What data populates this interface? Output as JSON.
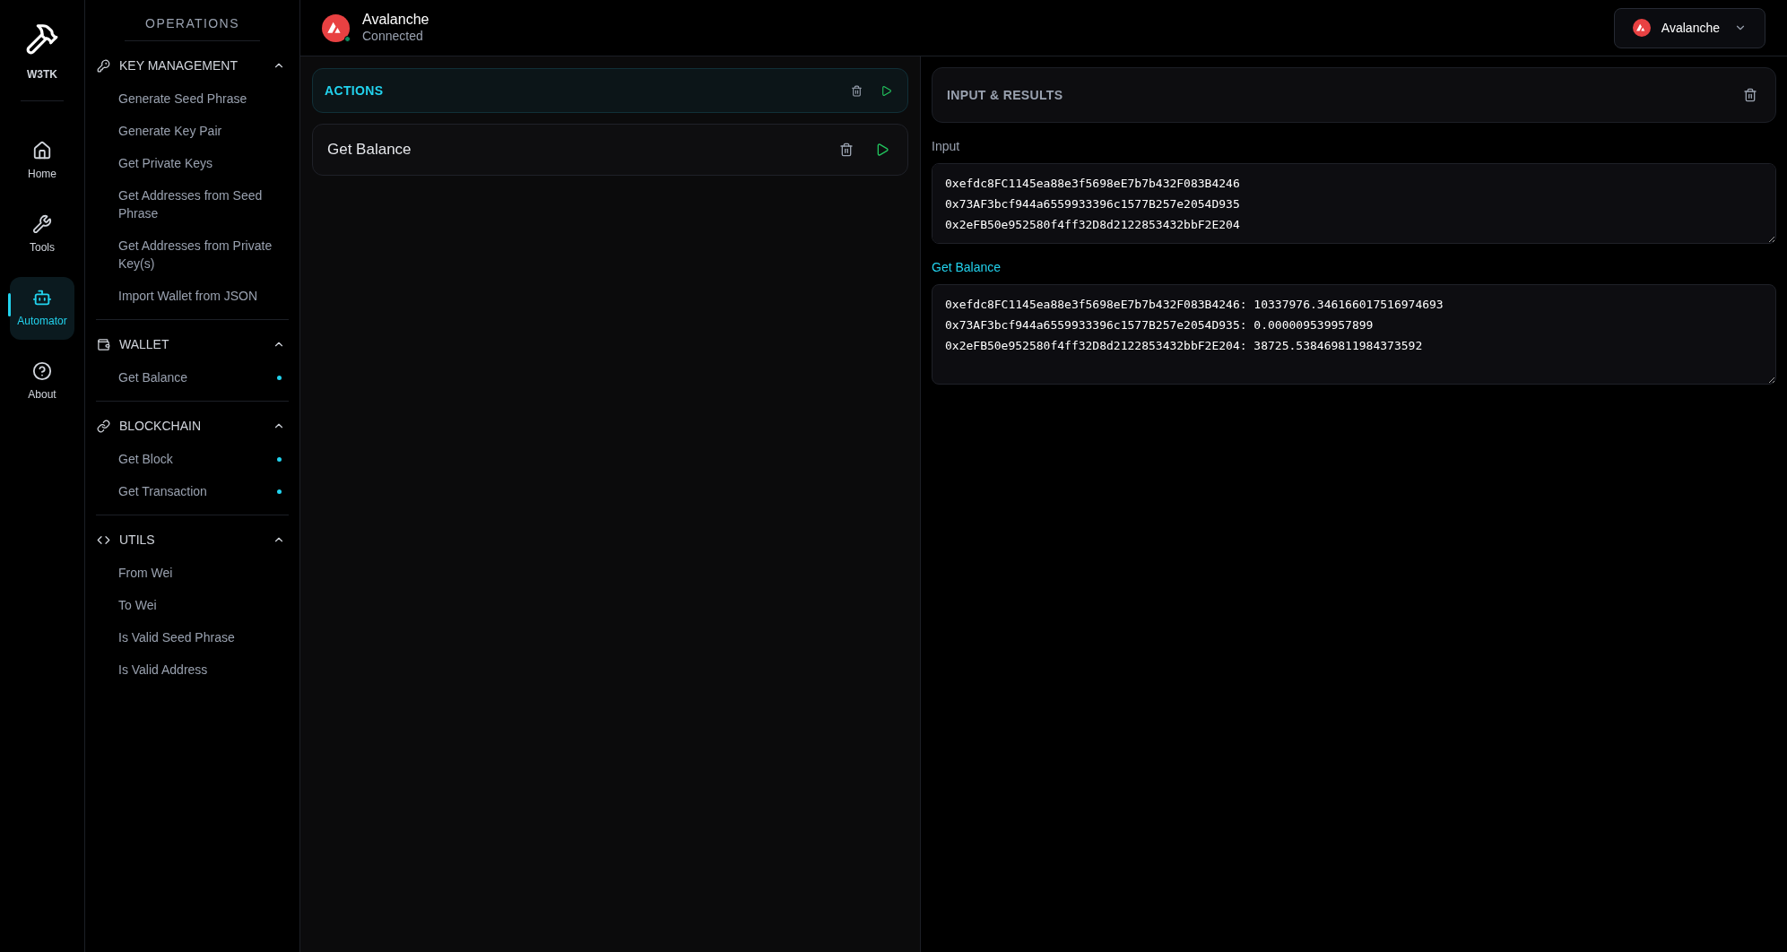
{
  "brand": {
    "name": "W3TK"
  },
  "nav": [
    {
      "label": "Home",
      "selected": false
    },
    {
      "label": "Tools",
      "selected": false
    },
    {
      "label": "Automator",
      "selected": true
    },
    {
      "label": "About",
      "selected": false
    }
  ],
  "operations": {
    "title": "OPERATIONS",
    "sections": [
      {
        "title": "KEY MANAGEMENT",
        "expanded": true,
        "items": [
          {
            "label": "Generate Seed Phrase",
            "marked": false
          },
          {
            "label": "Generate Key Pair",
            "marked": false
          },
          {
            "label": "Get Private Keys",
            "marked": false
          },
          {
            "label": "Get Addresses from Seed Phrase",
            "marked": false
          },
          {
            "label": "Get Addresses from Private Key(s)",
            "marked": false
          },
          {
            "label": "Import Wallet from JSON",
            "marked": false
          }
        ]
      },
      {
        "title": "WALLET",
        "expanded": true,
        "items": [
          {
            "label": "Get Balance",
            "marked": true
          }
        ]
      },
      {
        "title": "BLOCKCHAIN",
        "expanded": true,
        "items": [
          {
            "label": "Get Block",
            "marked": true
          },
          {
            "label": "Get Transaction",
            "marked": true
          }
        ]
      },
      {
        "title": "UTILS",
        "expanded": true,
        "items": [
          {
            "label": "From Wei",
            "marked": false
          },
          {
            "label": "To Wei",
            "marked": false
          },
          {
            "label": "Is Valid Seed Phrase",
            "marked": false
          },
          {
            "label": "Is Valid Address",
            "marked": false
          }
        ]
      }
    ]
  },
  "header": {
    "network": "Avalanche",
    "status": "Connected",
    "connected": true,
    "selector": "Avalanche"
  },
  "actions": {
    "title": "ACTIONS",
    "items": [
      {
        "label": "Get Balance"
      }
    ]
  },
  "results": {
    "title": "INPUT & RESULTS",
    "input_label": "Input",
    "input_lines": [
      "0xefdc8FC1145ea88e3f5698eE7b7b432F083B4246",
      "0x73AF3bcf944a6559933396c1577B257e2054D935",
      "0x2eFB50e952580f4ff32D8d2122853432bbF2E204"
    ],
    "output_label": "Get Balance",
    "output_lines": [
      "0xefdc8FC1145ea88e3f5698eE7b7b432F083B4246: 10337976.346166017516974693",
      "0x73AF3bcf944a6559933396c1577B257e2054D935: 0.000009539957899",
      "0x2eFB50e952580f4ff32D8d2122853432bbF2E204: 38725.538469811984373592"
    ]
  }
}
